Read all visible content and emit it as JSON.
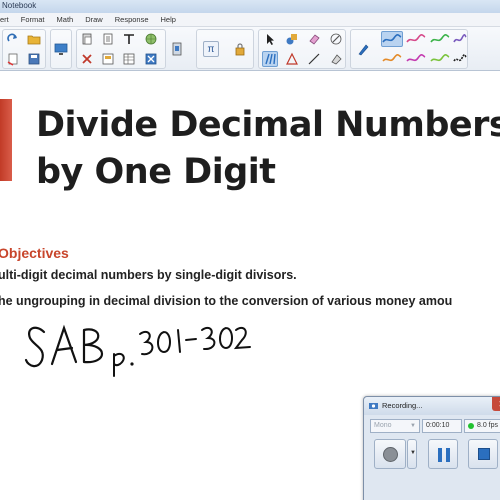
{
  "window": {
    "title": "Notebook"
  },
  "menu": [
    {
      "label": "ert"
    },
    {
      "label": "Format"
    },
    {
      "label": "Math"
    },
    {
      "label": "Draw"
    },
    {
      "label": "Response"
    },
    {
      "label": "Help"
    }
  ],
  "toolbar": {
    "pi_label": "π"
  },
  "slide": {
    "title_line1": "Divide Decimal Numbers",
    "title_line2": "by One Digit",
    "objectives_heading": "Objectives",
    "objective_1": "ulti-digit decimal numbers by single-digit divisors.",
    "objective_2": "he ungrouping in decimal division to the conversion of various money amou",
    "handwritten_note": "SAB p.301-302"
  },
  "recorder": {
    "title": "Recording...",
    "source": "Mono",
    "elapsed": "0:00:10",
    "fps": "8.0 fps",
    "status_color": "#21c130"
  },
  "colors": {
    "accent_red": "#d2402a",
    "objectives_red": "#c8452b",
    "pen_blue": "#2b6fbf"
  }
}
